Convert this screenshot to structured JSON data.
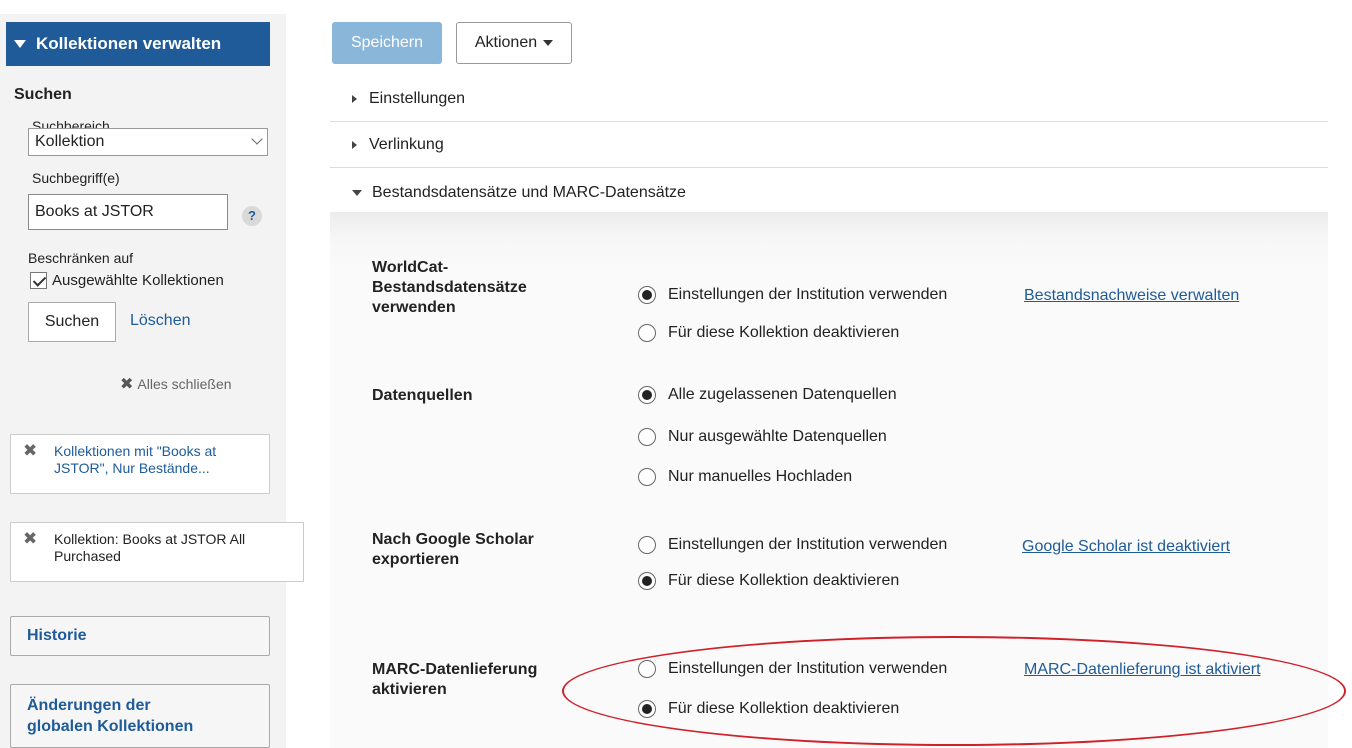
{
  "sidebar": {
    "header": "Kollektionen verwalten",
    "search_title": "Suchen",
    "scope_label": "Suchbereich",
    "scope_value": "Kollektion",
    "term_label": "Suchbegriff(e)",
    "term_value": "Books at JSTOR",
    "help": "?",
    "restrict_label": "Beschränken auf",
    "restrict_option": "Ausgewählte Kollektionen",
    "search_button": "Suchen",
    "clear_link": "Löschen",
    "close_all": "Alles schließen",
    "chips": [
      {
        "line1": "Kollektionen mit \"Books at",
        "line2": "JSTOR\", Nur Bestände..."
      },
      {
        "line1": "Kollektion: Books at JSTOR All",
        "line2": "Purchased"
      }
    ],
    "history": "Historie",
    "global_changes_line1": "Änderungen der",
    "global_changes_line2": "globalen Kollektionen"
  },
  "toolbar": {
    "save": "Speichern",
    "actions": "Aktionen"
  },
  "sections": {
    "settings": "Einstellungen",
    "linking": "Verlinkung",
    "holdings": "Bestandsdatensätze und MARC-Datensätze"
  },
  "fields": {
    "worldcat": {
      "label_l1": "WorldCat-",
      "label_l2": "Bestandsdatensätze",
      "label_l3": "verwenden",
      "opt1": "Einstellungen der Institution verwenden",
      "opt1_link": "Bestandsnachweise verwalten",
      "opt2": "Für diese Kollektion deaktivieren",
      "selected": 1
    },
    "sources": {
      "label": "Datenquellen",
      "opt1": "Alle zugelassenen Datenquellen",
      "opt2": "Nur ausgewählte Datenquellen",
      "opt3": "Nur manuelles Hochladen",
      "selected": 1
    },
    "scholar": {
      "label_l1": "Nach Google Scholar",
      "label_l2": "exportieren",
      "opt1": "Einstellungen der Institution verwenden",
      "opt1_link": "Google Scholar ist deaktiviert",
      "opt2": "Für diese Kollektion deaktivieren",
      "selected": 2
    },
    "marc": {
      "label_l1": "MARC-Datenlieferung",
      "label_l2": "aktivieren",
      "opt1": "Einstellungen der Institution verwenden",
      "opt1_link": "MARC-Datenlieferung ist aktiviert",
      "opt2": "Für diese Kollektion deaktivieren",
      "selected": 2
    }
  },
  "colors": {
    "header_blue": "#1e5b98",
    "save_disabled": "#8ab6da",
    "highlight_red": "#d0202a"
  }
}
